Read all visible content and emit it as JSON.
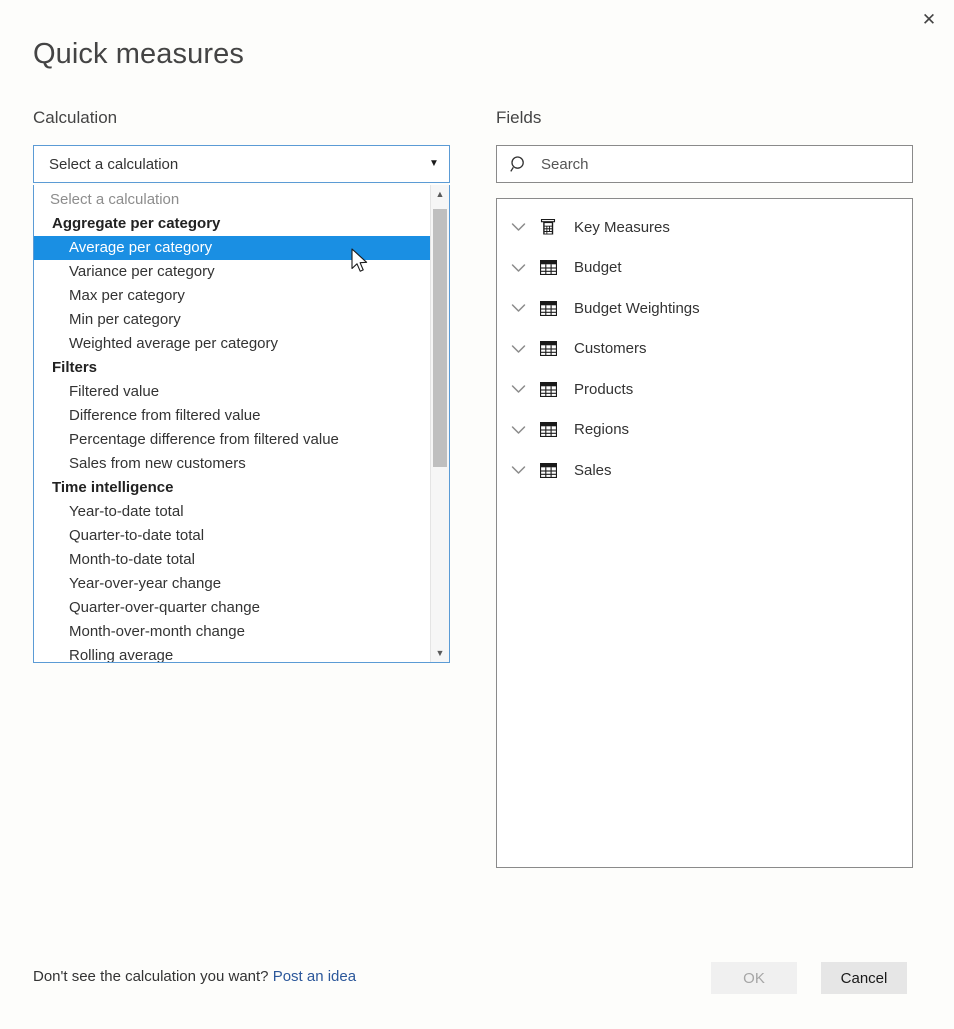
{
  "dialog": {
    "title": "Quick measures",
    "close_label": "✕"
  },
  "calculation": {
    "section_label": "Calculation",
    "combo_value": "Select a calculation",
    "combo_arrow": "▼",
    "options": [
      {
        "label": "Select a calculation",
        "type": "placeholder",
        "selected": false
      },
      {
        "label": "Aggregate per category",
        "type": "group",
        "selected": false
      },
      {
        "label": "Average per category",
        "type": "item",
        "selected": true
      },
      {
        "label": "Variance per category",
        "type": "item",
        "selected": false
      },
      {
        "label": "Max per category",
        "type": "item",
        "selected": false
      },
      {
        "label": "Min per category",
        "type": "item",
        "selected": false
      },
      {
        "label": "Weighted average per category",
        "type": "item",
        "selected": false
      },
      {
        "label": "Filters",
        "type": "group",
        "selected": false
      },
      {
        "label": "Filtered value",
        "type": "item",
        "selected": false
      },
      {
        "label": "Difference from filtered value",
        "type": "item",
        "selected": false
      },
      {
        "label": "Percentage difference from filtered value",
        "type": "item",
        "selected": false
      },
      {
        "label": "Sales from new customers",
        "type": "item",
        "selected": false
      },
      {
        "label": "Time intelligence",
        "type": "group",
        "selected": false
      },
      {
        "label": "Year-to-date total",
        "type": "item",
        "selected": false
      },
      {
        "label": "Quarter-to-date total",
        "type": "item",
        "selected": false
      },
      {
        "label": "Month-to-date total",
        "type": "item",
        "selected": false
      },
      {
        "label": "Year-over-year change",
        "type": "item",
        "selected": false
      },
      {
        "label": "Quarter-over-quarter change",
        "type": "item",
        "selected": false
      },
      {
        "label": "Month-over-month change",
        "type": "item",
        "selected": false
      },
      {
        "label": "Rolling average",
        "type": "item",
        "selected": false
      }
    ],
    "scrollbar": {
      "up_arrow": "▲",
      "down_arrow": "▼"
    }
  },
  "fields": {
    "section_label": "Fields",
    "search_placeholder": "Search",
    "search_value": "",
    "items": [
      {
        "label": "Key Measures",
        "icon": "measures-table-icon"
      },
      {
        "label": "Budget",
        "icon": "table-icon"
      },
      {
        "label": "Budget Weightings",
        "icon": "table-icon"
      },
      {
        "label": "Customers",
        "icon": "table-icon"
      },
      {
        "label": "Products",
        "icon": "table-icon"
      },
      {
        "label": "Regions",
        "icon": "table-icon"
      },
      {
        "label": "Sales",
        "icon": "table-icon"
      }
    ]
  },
  "footer": {
    "prompt": "Don't see the calculation you want?",
    "link": "Post an idea",
    "ok_label": "OK",
    "cancel_label": "Cancel"
  },
  "colors": {
    "selection_blue": "#1a8fe3",
    "link_blue": "#2b579a",
    "combo_border": "#5b9bd5",
    "panel_border": "#8a8a8a",
    "background": "#fdfdfb"
  }
}
